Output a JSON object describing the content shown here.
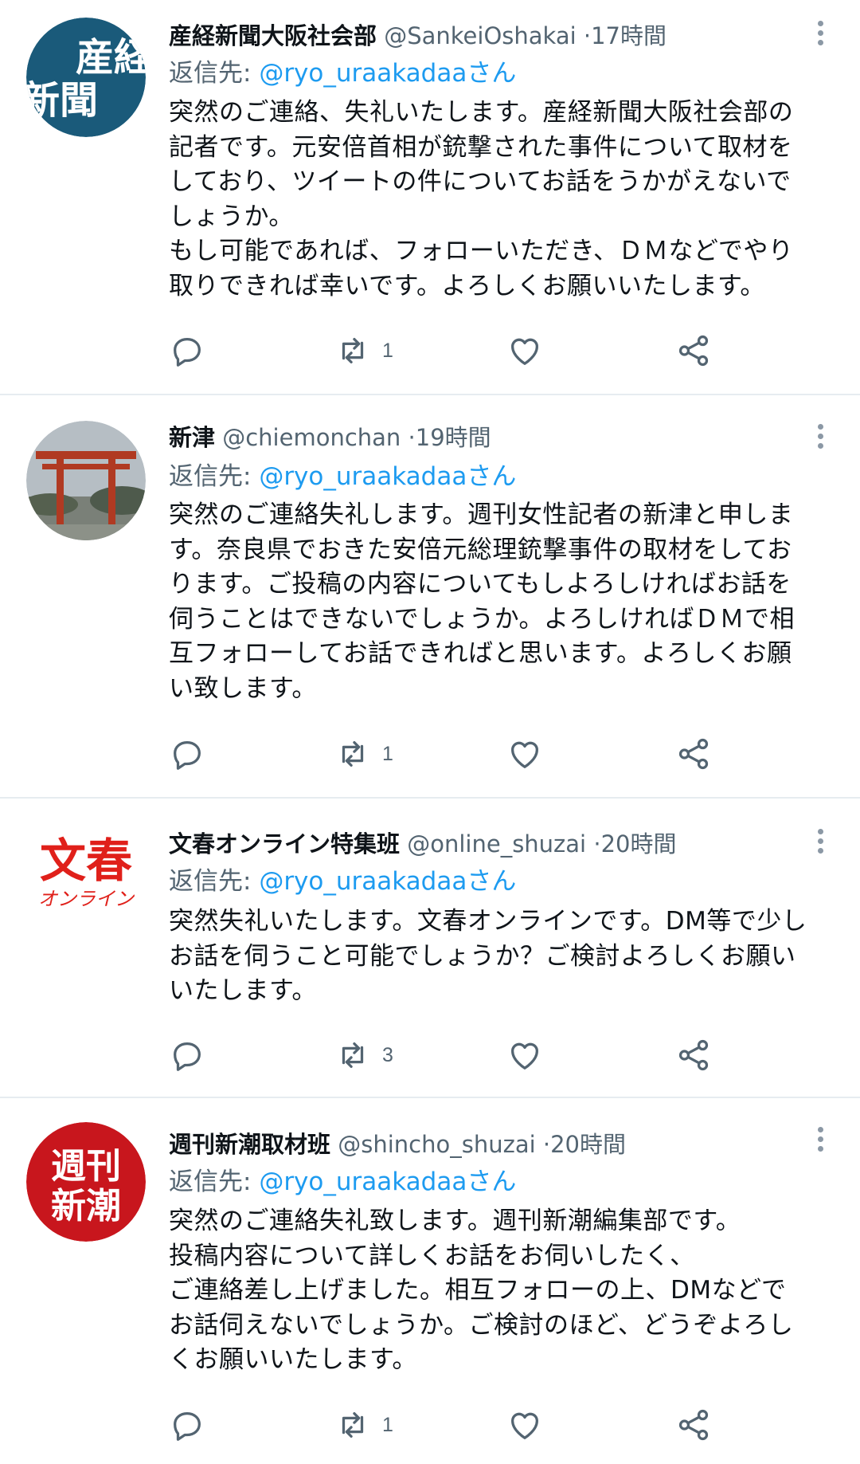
{
  "tweets": [
    {
      "name": "産経新聞大阪社会部",
      "handle": "@SankeiOshakai",
      "dot": "·",
      "time": "17時間",
      "reply_prefix": "返信先: ",
      "reply_mention": "@ryo_uraakadaaさん",
      "text": "突然のご連絡、失礼いたします。産経新聞大阪社会部の\n記者です。元安倍首相が銃撃された事件について取材を\nしており、ツイートの件についてお話をうかがえないで\nしょうか。\nもし可能であれば、フォローいただき、ＤＭなどでやり\n取りできれば幸いです。よろしくお願いいたします。",
      "avatar_text": [
        "産経",
        "新聞"
      ],
      "avatar_bg": "#1a5a7a",
      "retweet_count": "1",
      "reply_count": "",
      "like_count": ""
    },
    {
      "name": "新津",
      "handle": "@chiemonchan",
      "dot": "·",
      "time": "19時間",
      "reply_prefix": "返信先: ",
      "reply_mention": "@ryo_uraakadaaさん",
      "text": "突然のご連絡失礼します。週刊女性記者の新津と申しま\nす。奈良県でおきた安倍元総理銃撃事件の取材をしてお\nります。ご投稿の内容についてもしよろしければお話を\n伺うことはできないでしょうか。よろしければＤＭで相\n互フォローしてお話できればと思います。よろしくお願\nい致します。",
      "avatar_bg": "#9aa3a8",
      "retweet_count": "1",
      "reply_count": "",
      "like_count": ""
    },
    {
      "name": "文春オンライン特集班",
      "handle": "@online_shuzai",
      "dot": "·",
      "time": "20時間",
      "reply_prefix": "返信先: ",
      "reply_mention": "@ryo_uraakadaaさん",
      "text": "突然失礼いたします。文春オンラインです。DM等で少し\nお話を伺うこと可能でしょうか？ご検討よろしくお願い\nいたします。",
      "avatar_text": [
        "文春",
        "オンライン"
      ],
      "avatar_color": "#e0201a",
      "retweet_count": "3",
      "reply_count": "",
      "like_count": ""
    },
    {
      "name": "週刊新潮取材班",
      "handle": "@shincho_shuzai",
      "dot": "·",
      "time": "20時間",
      "reply_prefix": "返信先: ",
      "reply_mention": "@ryo_uraakadaaさん",
      "text": "突然のご連絡失礼致します。週刊新潮編集部です。\n投稿内容について詳しくお話をお伺いしたく、\nご連絡差し上げました。相互フォローの上、DMなどで\nお話伺えないでしょうか。ご検討のほど、どうぞよろし\nくお願いいたします。",
      "avatar_text": [
        "週刊",
        "新潮"
      ],
      "avatar_bg": "#c8161d",
      "retweet_count": "1",
      "reply_count": "",
      "like_count": ""
    }
  ],
  "colors": {
    "text": "#0f1419",
    "secondary": "#536471",
    "link": "#1d9bf0",
    "divider": "#e6ecf0"
  },
  "icons": {
    "reply": "reply-icon",
    "retweet": "retweet-icon",
    "like": "like-icon",
    "share": "share-icon",
    "more": "more-icon"
  }
}
